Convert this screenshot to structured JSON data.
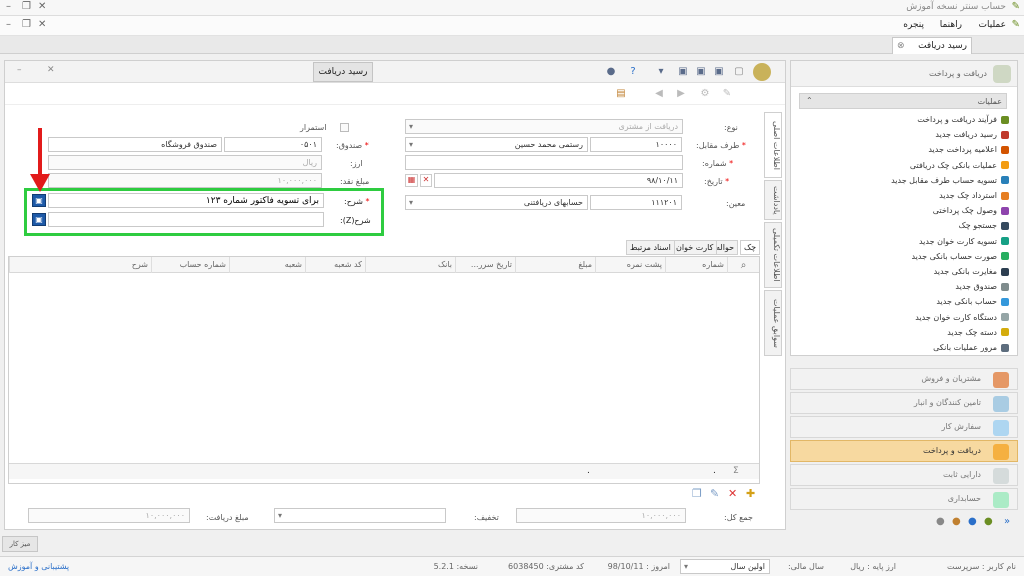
{
  "window": {
    "title": "حساب سنتر نسخه آموزش"
  },
  "menu": {
    "items": [
      "عملیات",
      "راهنما",
      "پنجره"
    ]
  },
  "doc_tab": {
    "label": "رسید دریافت"
  },
  "form": {
    "title": "رسید دریافت",
    "fields": {
      "type_label": "نوع:",
      "type_value": "دریافت از مشتری",
      "counterparty_label": "طرف مقابل:",
      "counterparty_code": "۱۰۰۰۰",
      "counterparty_name": "رستمی محمد حسین",
      "number_label": "شماره:",
      "date_label": "تاریخ:",
      "date_value": "۹۸/۱۰/۱۱",
      "moein_label": "معین:",
      "moein_code": "۱۱۱۲۰۱",
      "moein_name": "حسابهای دریافتنی",
      "cashbox_label": "صندوق:",
      "cashbox_code": "۰۵۰۱",
      "cashbox_name": "صندوق فروشگاه",
      "currency_label": "ارز:",
      "currency_value": "ریال",
      "cash_amount_label": "مبلغ نقد:",
      "cash_amount_value": "۱۰,۰۰۰,۰۰۰",
      "desc_label": "شرح:",
      "desc_value": "برای تسویه فاکتور شماره ۱۲۳",
      "desc2_label": "شرح(Z):",
      "istemrar_label": "استمرار"
    },
    "vertical_tabs": [
      "اطلاعات اصلی",
      "یادداشت",
      "اطلاعات تکمیلی",
      "سوابق عملیات"
    ],
    "sub_tabs": [
      "چک",
      "حواله",
      "کارت خوان",
      "اسناد مرتبط"
    ],
    "grid_columns": [
      "شماره",
      "پشت نمره",
      "مبلغ",
      "تاریخ سرر...",
      "بانک",
      "کد شعبه",
      "شعبه",
      "شماره حساب",
      "شرح"
    ],
    "grid_footer": {
      "sum_symbol": "Σ",
      "dot1": ".",
      "dot2": "."
    },
    "totals": {
      "total_label": "جمع کل:",
      "total_value": "۱۰,۰۰۰,۰۰۰",
      "discount_label": "تخفیف:",
      "discount_value": "",
      "received_label": "مبلغ دریافت:",
      "received_value": "۱۰,۰۰۰,۰۰۰"
    }
  },
  "right_panel": {
    "header": "دریافت و پرداخت",
    "section": "عملیات",
    "items": [
      "فرآیند دریافت و پرداخت",
      "رسید دریافت جدید",
      "اعلامیه پرداخت جدید",
      "عملیات بانکی چک دریافتی",
      "تسویه حساب طرف مقابل جدید",
      "استرداد چک جدید",
      "وصول چک پرداختی",
      "جستجو چک",
      "تسویه کارت خوان جدید",
      "صورت حساب بانکی جدید",
      "مغایرت بانکی جدید",
      "صندوق جدید",
      "حساب بانکی جدید",
      "دستگاه کارت خوان جدید",
      "دسته چک جدید",
      "مرور عملیات بانکی"
    ],
    "item_colors": [
      "#6b8e23",
      "#c0392b",
      "#d35400",
      "#f39c12",
      "#2980b9",
      "#e67e22",
      "#8e44ad",
      "#34495e",
      "#16a085",
      "#27ae60",
      "#2c3e50",
      "#7f8c8d",
      "#3498db",
      "#95a5a6",
      "#d4ac0d",
      "#5d6d7e"
    ]
  },
  "nav_buttons": [
    {
      "label": "مشتریان و فروش",
      "color": "#e59866"
    },
    {
      "label": "تامین کنندگان و انبار",
      "color": "#a9cce3"
    },
    {
      "label": "سفارش کار",
      "color": "#aed6f1"
    },
    {
      "label": "دریافت و پرداخت",
      "color": "#f5b041",
      "active": true
    },
    {
      "label": "دارایی ثابت",
      "color": "#d5dbdb"
    },
    {
      "label": "حسابداری",
      "color": "#abebc6"
    }
  ],
  "taskbar": {
    "label": "میز کار"
  },
  "status": {
    "user_label": "نام کاربر :",
    "user_value": "سرپرست",
    "base_currency_label": "ارز پایه :",
    "base_currency_value": "ریال",
    "fiscal_label": "سال مالی:",
    "fiscal_value": "اولین سال",
    "today_label": "امروز :",
    "today_value": "98/10/11",
    "customer_code_label": "کد مشتری:",
    "customer_code_value": "6038450",
    "version_label": "نسخه:",
    "version_value": "5.2.1",
    "support_link": "پشتیبانی و آموزش"
  }
}
